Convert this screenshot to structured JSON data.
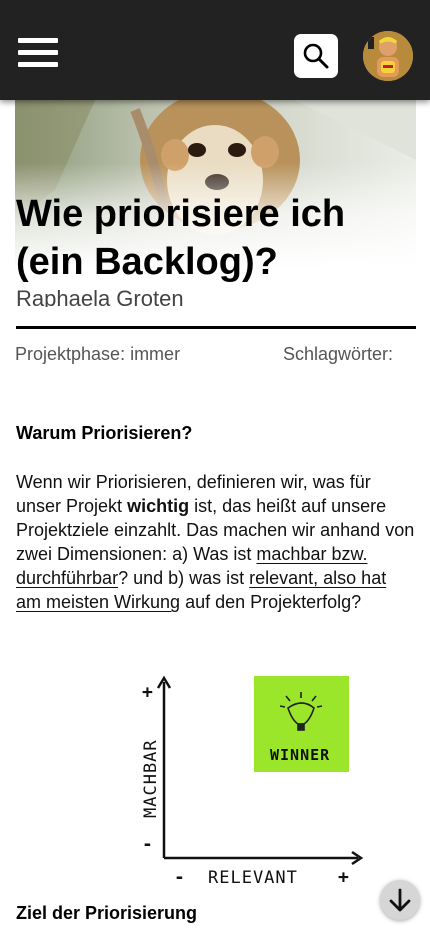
{
  "header": {
    "menu_icon": "hamburger-menu-icon",
    "search_icon": "search-icon",
    "avatar_icon": "user-avatar"
  },
  "article": {
    "title": "Wie priorisiere ich (ein Backlog)?",
    "author": "Raphaela Groten",
    "phase": "Projektphase: immer",
    "keywords": "Schlagwörter:",
    "section1_heading": "Warum Priorisieren?",
    "para": {
      "t1": "Wenn wir Priorisieren, definieren wir, was für unser Projekt ",
      "bold": "wichtig",
      "t2": " ist, das heißt auf unsere Projektziele einzahlt. Das machen wir anhand von zwei Dimensionen: a) Was ist ",
      "link1": "machbar bzw. durchführbar",
      "t3": "? und b) was ist ",
      "link2": "relevant, also hat am meisten Wirkung",
      "t4": " auf den Projekterfolg?"
    },
    "diagram": {
      "y_axis": "MACHBAR",
      "x_axis": "RELEVANT",
      "box_label": "WINNER",
      "plus": "+",
      "minus": "-"
    },
    "section2_heading": "Ziel der Priorisierung"
  },
  "colors": {
    "topbar": "#222222",
    "winner_box": "#9be62a",
    "text": "#111111"
  },
  "scroll_icon": "arrow-down-icon"
}
